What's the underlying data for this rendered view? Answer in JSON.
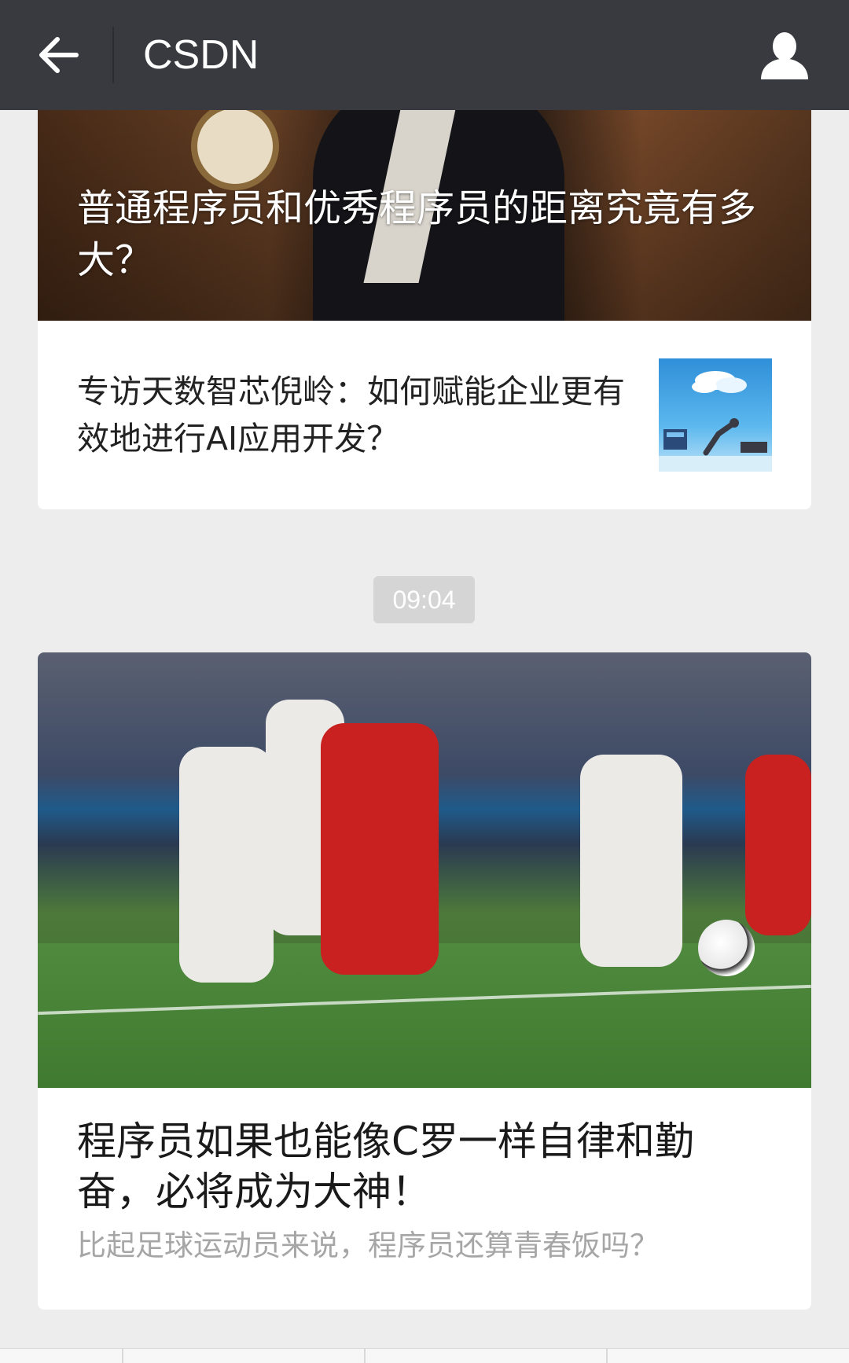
{
  "header": {
    "title": "CSDN",
    "back_icon": "arrow-left-icon",
    "profile_icon": "person-icon"
  },
  "card_top": {
    "cover_title": "普通程序员和优秀程序员的距离究竟有多大？",
    "item_title": "专访天数智芯倪岭：如何赋能企业更有效地进行AI应用开发？"
  },
  "timestamp": "09:04",
  "card_bottom": {
    "title": "程序员如果也能像C罗一样自律和勤奋，必将成为大神！",
    "subtitle": "比起足球运动员来说，程序员还算青春饭吗？"
  },
  "colors": {
    "topbar": "#393a3f",
    "background": "#ededed",
    "timestamp_bg": "#d5d5d5",
    "subtitle_text": "#a6a6a6"
  }
}
